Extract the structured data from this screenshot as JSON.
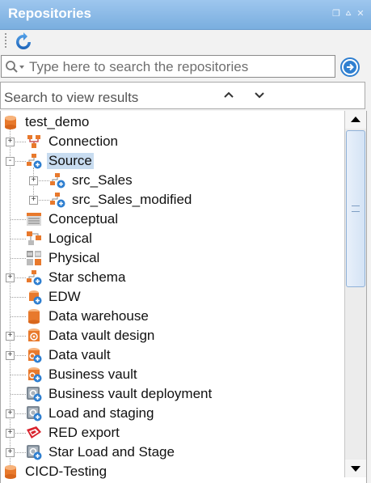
{
  "panel": {
    "title": "Repositories",
    "controls": [
      "restore-icon",
      "pin-icon",
      "close-icon"
    ]
  },
  "toolbar": {
    "refresh_icon": "refresh-icon"
  },
  "search": {
    "placeholder": "Type here to search the repositories",
    "value": "",
    "go_icon": "arrow-right-circle-icon"
  },
  "results": {
    "label": "Search to view results"
  },
  "tree": {
    "selected": "Source",
    "items": [
      {
        "label": "test_demo",
        "level": 0,
        "toggle": "",
        "icon": "database-icon"
      },
      {
        "label": "Connection",
        "level": 1,
        "toggle": "+",
        "icon": "connection-icon"
      },
      {
        "label": "Source",
        "level": 1,
        "toggle": "-",
        "icon": "source-hierarchy-icon"
      },
      {
        "label": "src_Sales",
        "level": 2,
        "toggle": "+",
        "icon": "source-hierarchy-icon"
      },
      {
        "label": "src_Sales_modified",
        "level": 2,
        "toggle": "+",
        "icon": "source-hierarchy-icon"
      },
      {
        "label": "Conceptual",
        "level": 1,
        "toggle": "",
        "icon": "conceptual-model-icon"
      },
      {
        "label": "Logical",
        "level": 1,
        "toggle": "",
        "icon": "logical-model-icon"
      },
      {
        "label": "Physical",
        "level": 1,
        "toggle": "",
        "icon": "physical-model-icon"
      },
      {
        "label": "Star schema",
        "level": 1,
        "toggle": "+",
        "icon": "star-schema-icon"
      },
      {
        "label": "EDW",
        "level": 1,
        "toggle": "",
        "icon": "edw-icon"
      },
      {
        "label": "Data warehouse",
        "level": 1,
        "toggle": "",
        "icon": "data-warehouse-icon"
      },
      {
        "label": "Data vault design",
        "level": 1,
        "toggle": "+",
        "icon": "data-vault-design-icon"
      },
      {
        "label": "Data vault",
        "level": 1,
        "toggle": "+",
        "icon": "data-vault-icon"
      },
      {
        "label": "Business vault",
        "level": 1,
        "toggle": "",
        "icon": "business-vault-icon"
      },
      {
        "label": "Business vault deployment",
        "level": 1,
        "toggle": "",
        "icon": "deployment-icon"
      },
      {
        "label": "Load and staging",
        "level": 1,
        "toggle": "+",
        "icon": "load-staging-icon"
      },
      {
        "label": "RED export",
        "level": 1,
        "toggle": "+",
        "icon": "red-export-icon"
      },
      {
        "label": "Star Load and Stage",
        "level": 1,
        "toggle": "+",
        "icon": "load-staging-icon"
      },
      {
        "label": "CICD-Testing",
        "level": 0,
        "toggle": "",
        "icon": "database-icon"
      }
    ]
  },
  "colors": {
    "title_bar": "#7aaedf",
    "selection": "#c8dcf0",
    "accent_blue": "#2f7fd0",
    "db_orange": "#e8792c"
  }
}
